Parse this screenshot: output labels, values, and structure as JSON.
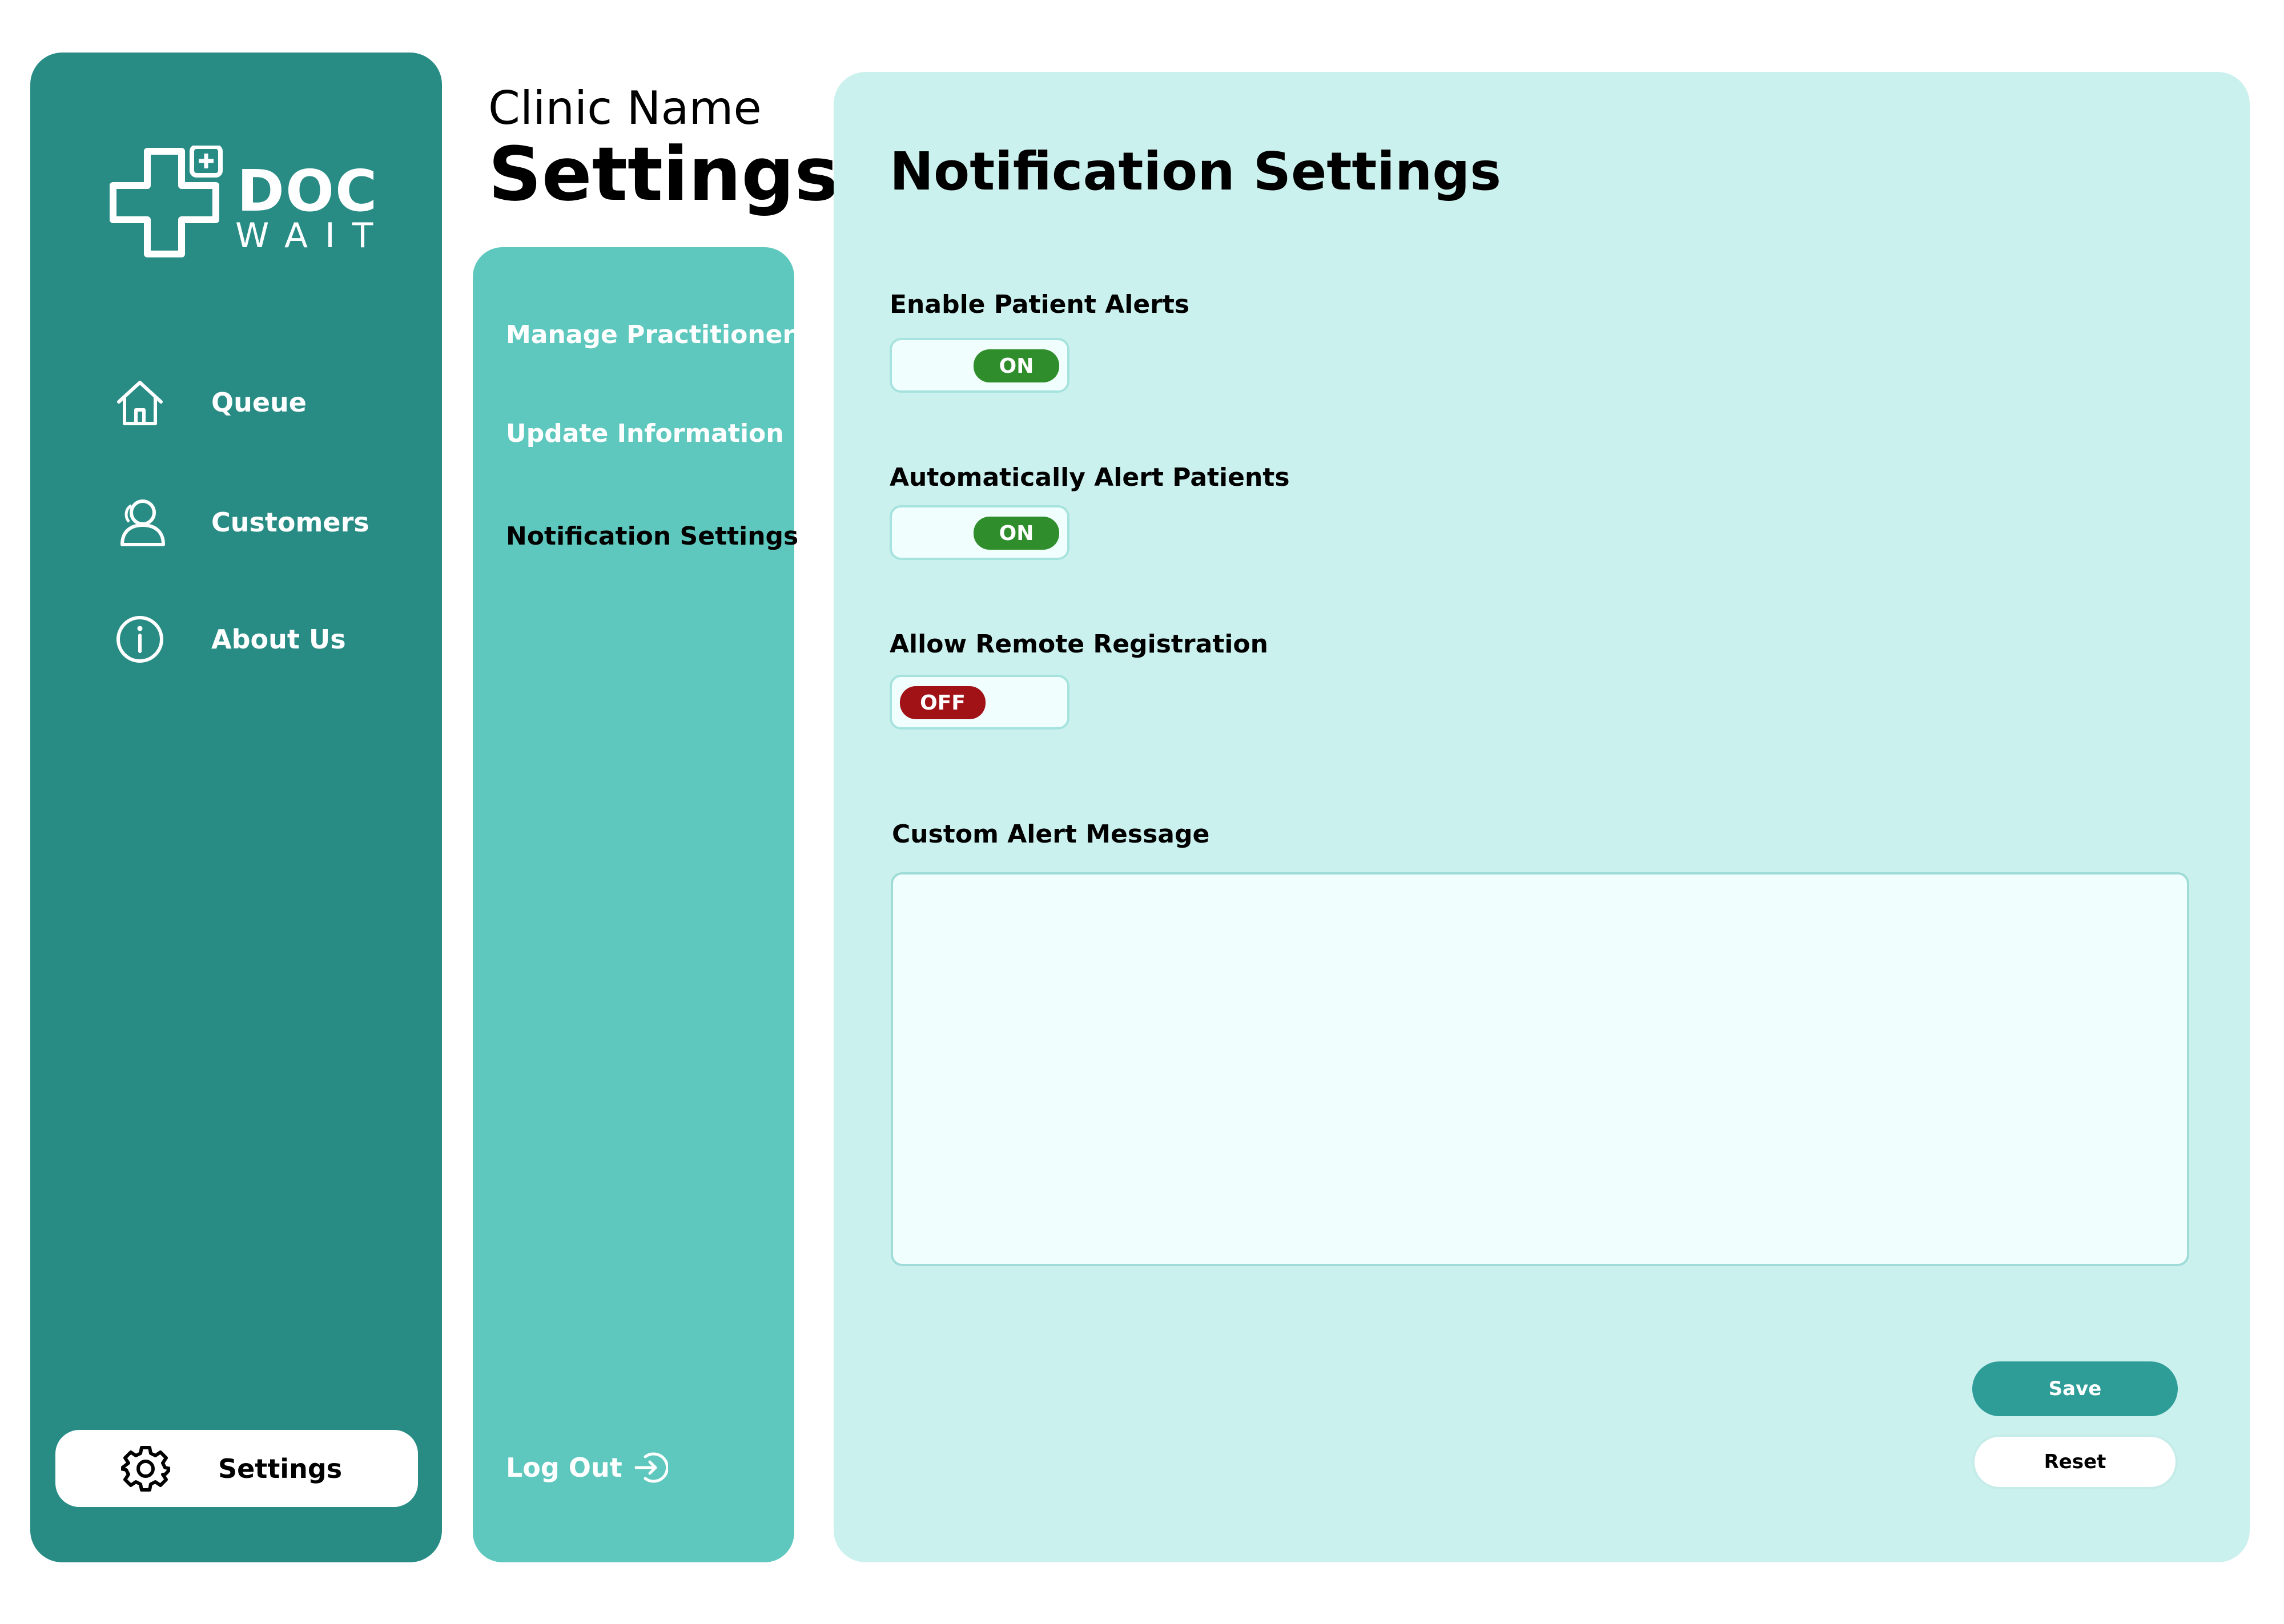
{
  "brand": {
    "name_top": "DOC",
    "name_bottom": "WAIT"
  },
  "sidebar": {
    "items": [
      {
        "label": "Queue",
        "icon": "home-icon"
      },
      {
        "label": "Customers",
        "icon": "users-icon"
      },
      {
        "label": "About Us",
        "icon": "info-icon"
      }
    ],
    "settings": {
      "label": "Settings",
      "icon": "gear-icon"
    }
  },
  "header": {
    "clinic_name": "Clinic Name",
    "title": "Settings"
  },
  "subnav": {
    "items": [
      {
        "label": "Manage Practitioners",
        "active": false
      },
      {
        "label": "Update Information",
        "active": false
      },
      {
        "label": "Notification Settings",
        "active": true
      }
    ],
    "logout": {
      "label": "Log Out",
      "icon": "logout-icon"
    }
  },
  "main": {
    "title": "Notification Settings",
    "settings": [
      {
        "label": "Enable Patient Alerts",
        "state": "ON"
      },
      {
        "label": "Automatically Alert Patients",
        "state": "ON"
      },
      {
        "label": "Allow Remote Registration",
        "state": "OFF"
      }
    ],
    "custom_message": {
      "label": "Custom Alert Message",
      "value": ""
    },
    "buttons": {
      "save": "Save",
      "reset": "Reset"
    }
  },
  "colors": {
    "sidebar": "#288c85",
    "subnav": "#5fc8be",
    "main_bg": "#cbf1ef",
    "toggle_on": "#2f8e2b",
    "toggle_off": "#a11217",
    "save_button": "#2e9d97"
  }
}
